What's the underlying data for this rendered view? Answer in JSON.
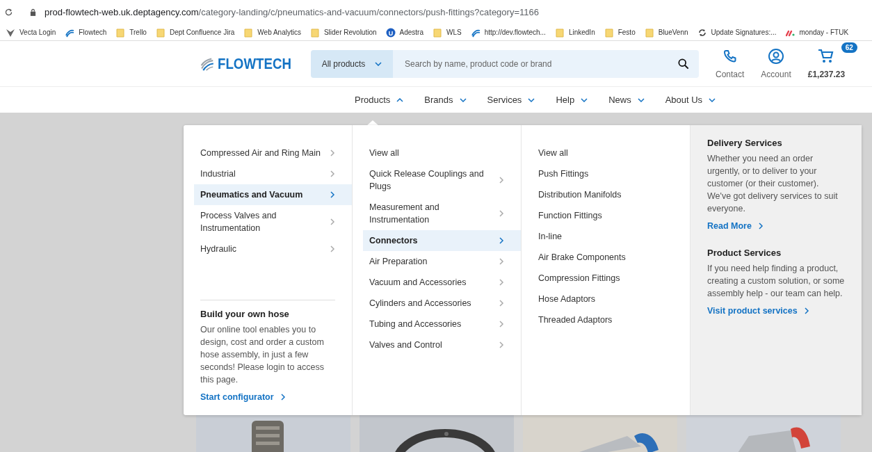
{
  "browser": {
    "url_host": "prod-flowtech-web.uk.deptagency.com",
    "url_path": "/category-landing/c/pneumatics-and-vacuum/connectors/push-fittings?category=1166",
    "bookmarks": [
      {
        "label": "Vecta Login",
        "kind": "triangle"
      },
      {
        "label": "Flowtech",
        "kind": "swirl"
      },
      {
        "label": "Trello",
        "kind": "folder"
      },
      {
        "label": "Dept Confluence Jira",
        "kind": "folder"
      },
      {
        "label": "Web Analytics",
        "kind": "folder"
      },
      {
        "label": "Slider Revolution",
        "kind": "folder"
      },
      {
        "label": "Adestra",
        "kind": "circle",
        "glyph": "U"
      },
      {
        "label": "WLS",
        "kind": "folder"
      },
      {
        "label": "http://dev.flowtech...",
        "kind": "swirl"
      },
      {
        "label": "LinkedIn",
        "kind": "folder"
      },
      {
        "label": "Festo",
        "kind": "folder"
      },
      {
        "label": "BlueVenn",
        "kind": "folder"
      },
      {
        "label": "Update Signatures:...",
        "kind": "sync"
      },
      {
        "label": "monday - FTUK",
        "kind": "dots"
      }
    ]
  },
  "header": {
    "logo": "FLOWTECH",
    "category_select": "All products",
    "search_placeholder": "Search by name, product code or brand",
    "actions": [
      {
        "label": "Contact",
        "kind": "phone"
      },
      {
        "label": "Account",
        "kind": "account"
      }
    ],
    "cart": {
      "badge": "62",
      "total": "£1,237.23"
    }
  },
  "nav": [
    {
      "label": "Products",
      "expanded": true
    },
    {
      "label": "Brands",
      "expanded": false
    },
    {
      "label": "Services",
      "expanded": false
    },
    {
      "label": "Help",
      "expanded": false
    },
    {
      "label": "News",
      "expanded": false
    },
    {
      "label": "About Us",
      "expanded": false
    }
  ],
  "menu": {
    "column_1": {
      "items": [
        {
          "label": "Compressed Air and Ring Main",
          "selected": false
        },
        {
          "label": "Industrial",
          "selected": false
        },
        {
          "label": "Pneumatics and Vacuum",
          "selected": true
        },
        {
          "label": "Process Valves and Instrumentation",
          "selected": false
        },
        {
          "label": "Hydraulic",
          "selected": false
        }
      ],
      "promo": {
        "title": "Build your own hose",
        "text": "Our online tool enables you to design, cost and order a custom hose assembly, in just a few seconds! Please login to access this page.",
        "link": "Start configurator"
      }
    },
    "column_2": {
      "items": [
        {
          "label": "View all",
          "kind": "link",
          "selected": false
        },
        {
          "label": "Quick Release Couplings and Plugs",
          "kind": "category",
          "selected": false
        },
        {
          "label": "Measurement and Instrumentation",
          "kind": "category",
          "selected": false
        },
        {
          "label": "Connectors",
          "kind": "category",
          "selected": true
        },
        {
          "label": "Air Preparation",
          "kind": "category",
          "selected": false
        },
        {
          "label": "Vacuum and Accessories",
          "kind": "category",
          "selected": false
        },
        {
          "label": "Cylinders and Accessories",
          "kind": "category",
          "selected": false
        },
        {
          "label": "Tubing and Accessories",
          "kind": "category",
          "selected": false
        },
        {
          "label": "Valves and Control",
          "kind": "category",
          "selected": false
        }
      ]
    },
    "column_3": {
      "items": [
        {
          "label": "View all"
        },
        {
          "label": "Push Fittings"
        },
        {
          "label": "Distribution Manifolds"
        },
        {
          "label": "Function Fittings"
        },
        {
          "label": "In-line"
        },
        {
          "label": "Air Brake Components"
        },
        {
          "label": "Compression Fittings"
        },
        {
          "label": "Hose Adaptors"
        },
        {
          "label": "Threaded Adaptors"
        }
      ]
    },
    "column_4": {
      "services": [
        {
          "title": "Delivery Services",
          "text": "Whether you need an order urgently, or to deliver to your customer (or their customer). We've got delivery services to suit everyone.",
          "link": "Read More"
        },
        {
          "title": "Product Services",
          "text": "If you need help finding a product, creating a custom solution, or some assembly help - our team can help.",
          "link": "Visit product services"
        }
      ]
    }
  }
}
